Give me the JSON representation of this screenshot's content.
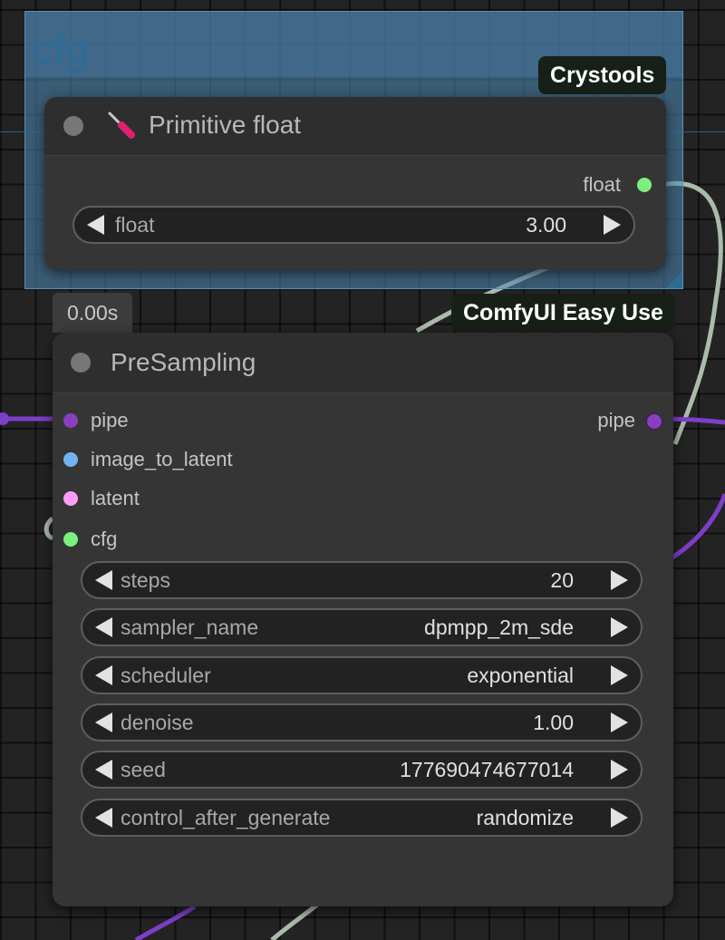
{
  "colors": {
    "canvas_bg": "#232323",
    "group_fill": "#508cb9",
    "group_title": "#2e6c98",
    "node_bg": "#353535",
    "pipe_slot": "#8a3fc1",
    "image_slot": "#6fb4f0",
    "latent_slot": "#ff9cf9",
    "float_slot": "#7cf07c",
    "link_pipe": "#7d3ec8",
    "link_float": "#a9bba9"
  },
  "group": {
    "title": "cfg"
  },
  "badges": {
    "crystools": "Crystools",
    "easy_use": "ComfyUI Easy Use",
    "exec_time": "0.00s"
  },
  "primitive_node": {
    "icon": "screwdriver-icon",
    "title": "Primitive float",
    "output_label": "float",
    "widget": {
      "label": "float",
      "value": "3.00"
    }
  },
  "presampling_node": {
    "title": "PreSampling",
    "inputs": [
      {
        "label": "pipe",
        "type": "PIPE_LINE"
      },
      {
        "label": "image_to_latent",
        "type": "IMAGE"
      },
      {
        "label": "latent",
        "type": "LATENT"
      },
      {
        "label": "cfg",
        "type": "FLOAT"
      }
    ],
    "output_label": "pipe",
    "widgets": [
      {
        "label": "steps",
        "value": "20"
      },
      {
        "label": "sampler_name",
        "value": "dpmpp_2m_sde"
      },
      {
        "label": "scheduler",
        "value": "exponential"
      },
      {
        "label": "denoise",
        "value": "1.00"
      },
      {
        "label": "seed",
        "value": "177690474677014"
      },
      {
        "label": "control_after_generate",
        "value": "randomize"
      }
    ]
  }
}
